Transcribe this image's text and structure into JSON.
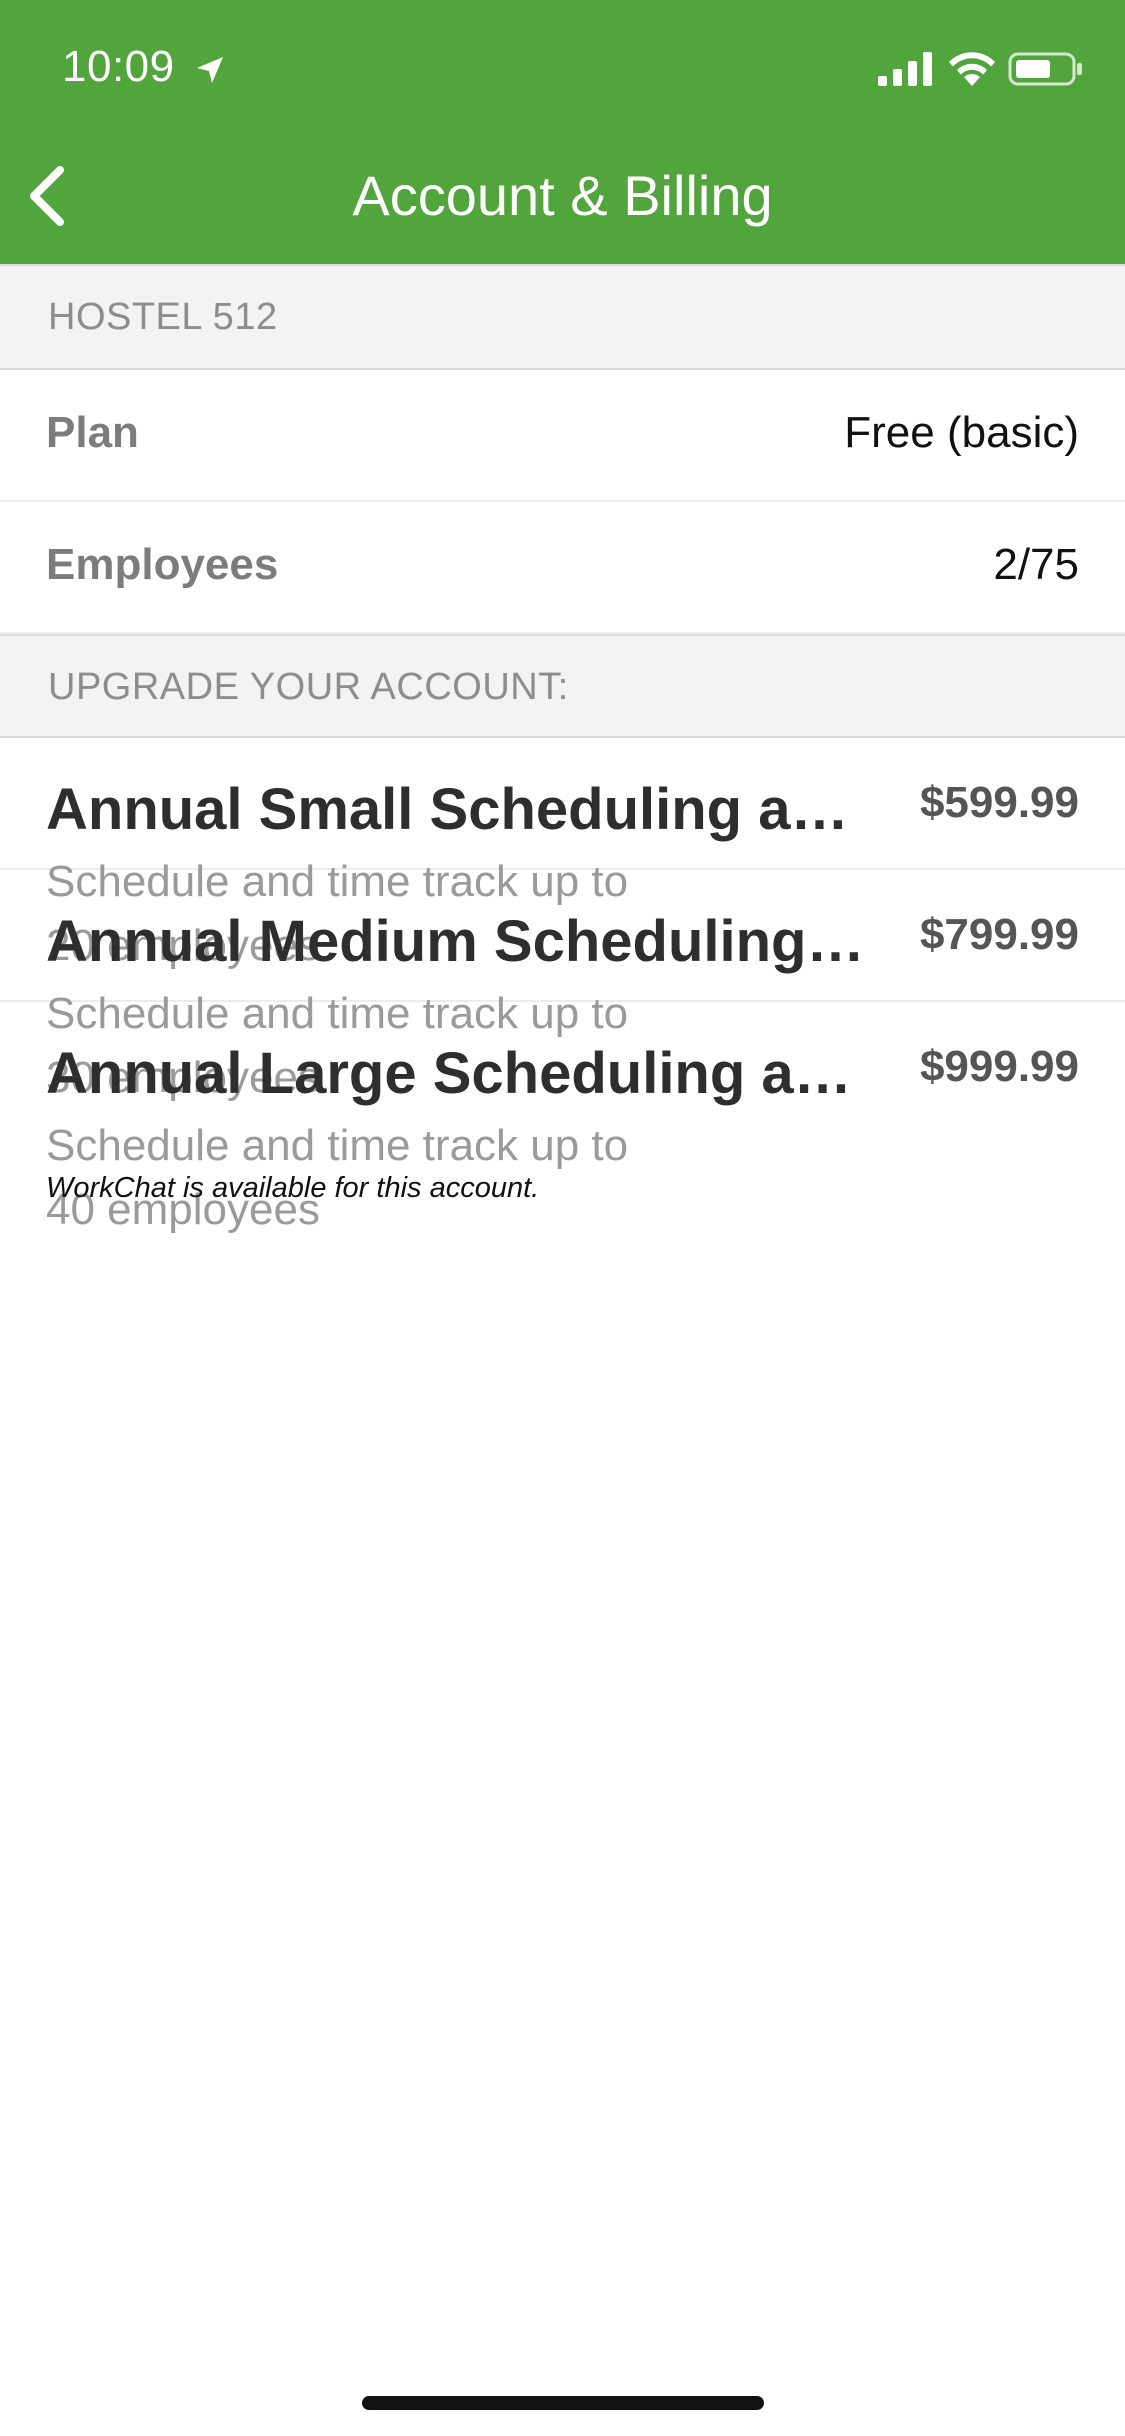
{
  "status_bar": {
    "time": "10:09",
    "icons": [
      "location-arrow-icon",
      "signal-icon",
      "wifi-icon",
      "battery-icon"
    ]
  },
  "header": {
    "title": "Account & Billing",
    "back_icon": "chevron-left-icon",
    "background_color": "#52a43c"
  },
  "account": {
    "section_title": "HOSTEL 512",
    "rows": [
      {
        "label": "Plan",
        "value": "Free (basic)"
      },
      {
        "label": "Employees",
        "value": "2/75"
      }
    ]
  },
  "upgrade": {
    "section_title": "UPGRADE YOUR ACCOUNT:",
    "plans": [
      {
        "title": "Annual Small Scheduling and Time Tracking",
        "price": "$599.99",
        "description": "Schedule and time track up to 20 employees"
      },
      {
        "title": "Annual Medium Scheduling and Time Tracking",
        "price": "$799.99",
        "description": "Schedule and time track up to 30 employees"
      },
      {
        "title": "Annual Large Scheduling and Time Tracking",
        "price": "$999.99",
        "description": "Schedule and time track up to 40 employees"
      }
    ]
  },
  "footnote": "WorkChat is available for this account."
}
